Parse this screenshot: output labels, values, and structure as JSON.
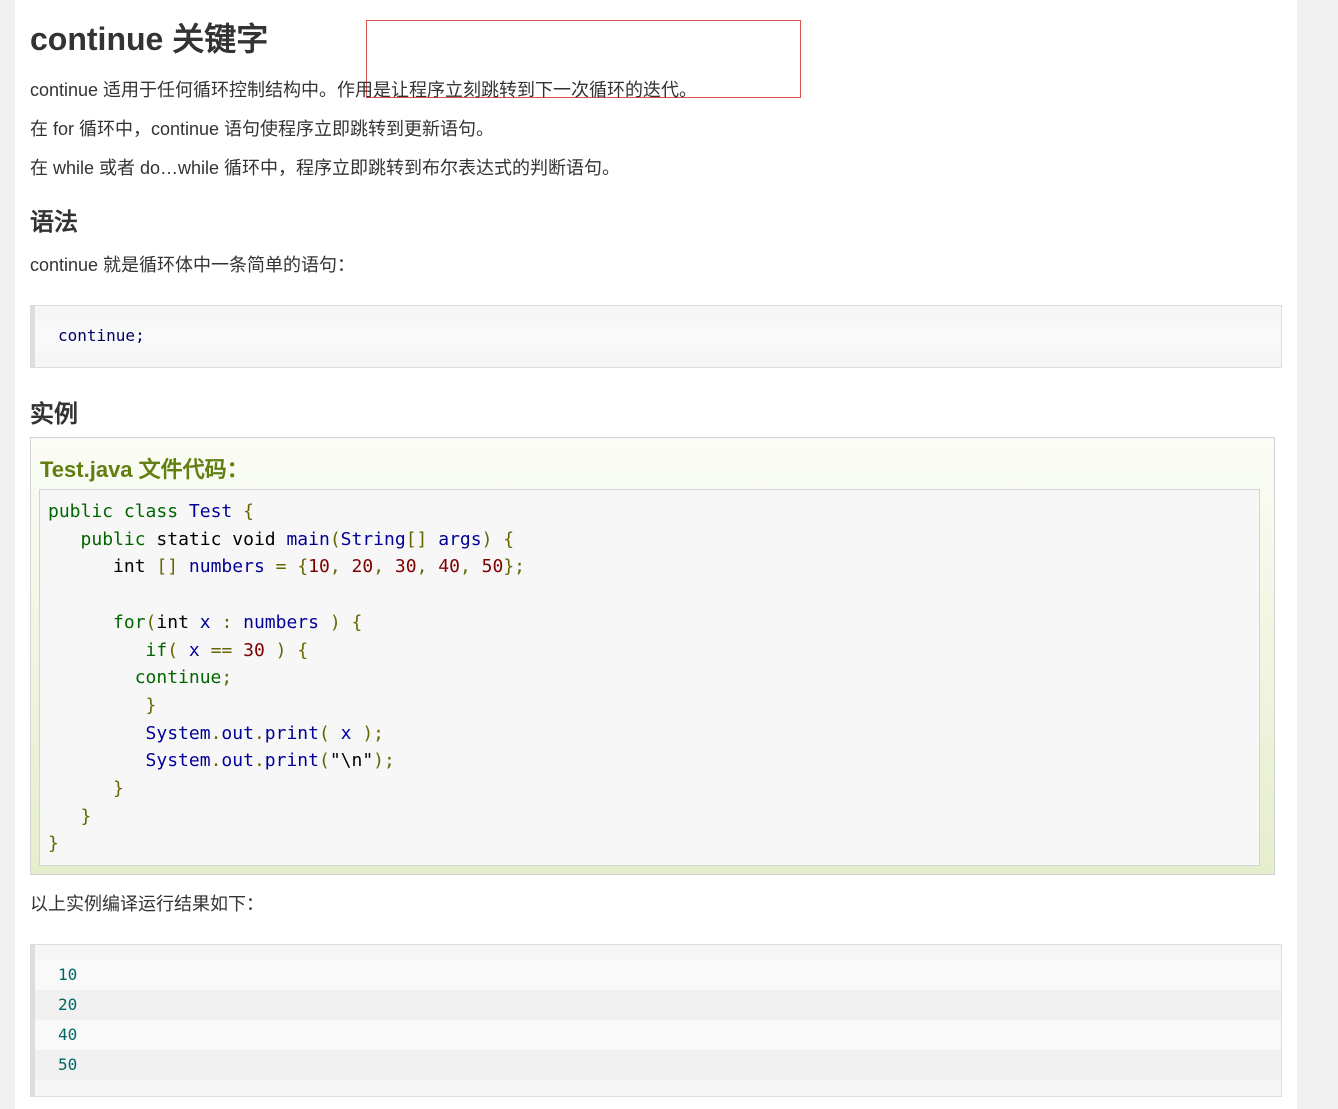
{
  "heading": "continue 关键字",
  "intro": [
    "continue 适用于任何循环控制结构中。作用是让程序立刻跳转到下一次循环的迭代。",
    "在 for 循环中，continue 语句使程序立即跳转到更新语句。",
    "在 while 或者 do…while 循环中，程序立即跳转到布尔表达式的判断语句。"
  ],
  "syntax_heading": "语法",
  "syntax_desc": "continue 就是循环体中一条简单的语句：",
  "syntax_code": "continue;",
  "example_heading": "实例",
  "example_title": "Test.java 文件代码：",
  "example_code_lines": [
    "public class Test {",
    "   public static void main(String[] args) {",
    "      int [] numbers = {10, 20, 30, 40, 50};",
    "",
    "      for(int x : numbers ) {",
    "         if( x == 30 ) {",
    "        continue;",
    "         }",
    "         System.out.print( x );",
    "         System.out.print(\"\\n\");",
    "      }",
    "   }",
    "}"
  ],
  "result_desc": "以上实例编译运行结果如下：",
  "output_lines": [
    "10",
    "20",
    "40",
    "50"
  ],
  "colors": {
    "highlight_border": "#d9534f",
    "example_title": "#617f10",
    "keyword": "#006600",
    "identifier": "#000099",
    "number": "#800000"
  }
}
